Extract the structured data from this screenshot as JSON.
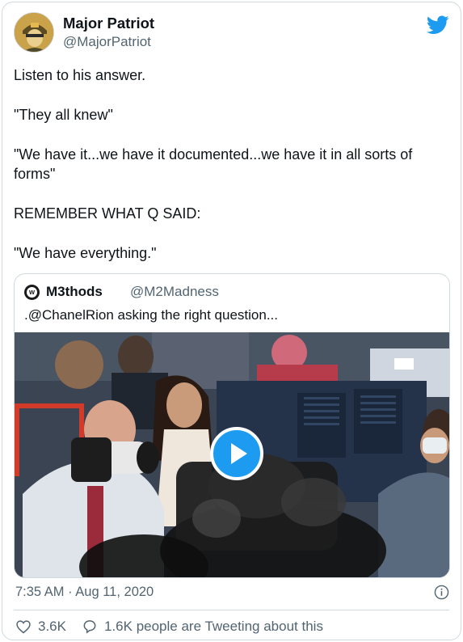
{
  "author": {
    "name": "Major Patriot",
    "handle": "@MajorPatriot",
    "avatar_icon": "soldier-avatar-icon"
  },
  "platform_icon": "twitter-bird-icon",
  "brand_color": "#1d9bf0",
  "tweet_lines": [
    "Listen to his answer.",
    "\"They all knew\"",
    "\"We have it...we have it documented...we have it in all sorts of forms\"",
    "REMEMBER WHAT Q SAID:",
    "\"We have everything.\""
  ],
  "quoted_tweet": {
    "name": "M3thods",
    "handle": "@M2Madness",
    "avatar_icon": "m3thods-avatar-icon",
    "text": ".@ChanelRion asking the right question...",
    "media": {
      "type": "video",
      "play_icon": "play-button-icon"
    }
  },
  "timestamp": "7:35 AM · Aug 11, 2020",
  "stats": {
    "likes": "3.6K",
    "replies_text": "1.6K people are Tweeting about this"
  }
}
